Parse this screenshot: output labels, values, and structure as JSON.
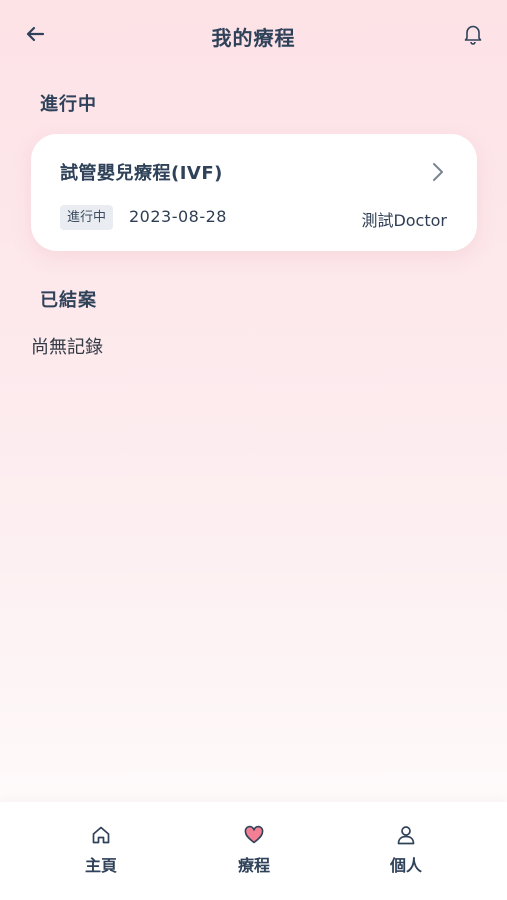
{
  "header": {
    "title": "我的療程",
    "back_icon": "arrow-left-icon",
    "notification_icon": "bell-icon"
  },
  "sections": {
    "active": {
      "title": "進行中",
      "items": [
        {
          "title": "試管嬰兒療程(IVF)",
          "status": "進行中",
          "date": "2023-08-28",
          "doctor": "測試Doctor"
        }
      ]
    },
    "closed": {
      "title": "已結案",
      "empty_text": "尚無記錄"
    }
  },
  "tabbar": {
    "items": [
      {
        "label": "主頁",
        "icon": "home-icon"
      },
      {
        "label": "療程",
        "icon": "heart-icon",
        "active": true
      },
      {
        "label": "個人",
        "icon": "user-icon"
      }
    ]
  },
  "colors": {
    "accent": "#f27f93",
    "text": "#2f4259",
    "badge_bg": "#e9edf1"
  }
}
